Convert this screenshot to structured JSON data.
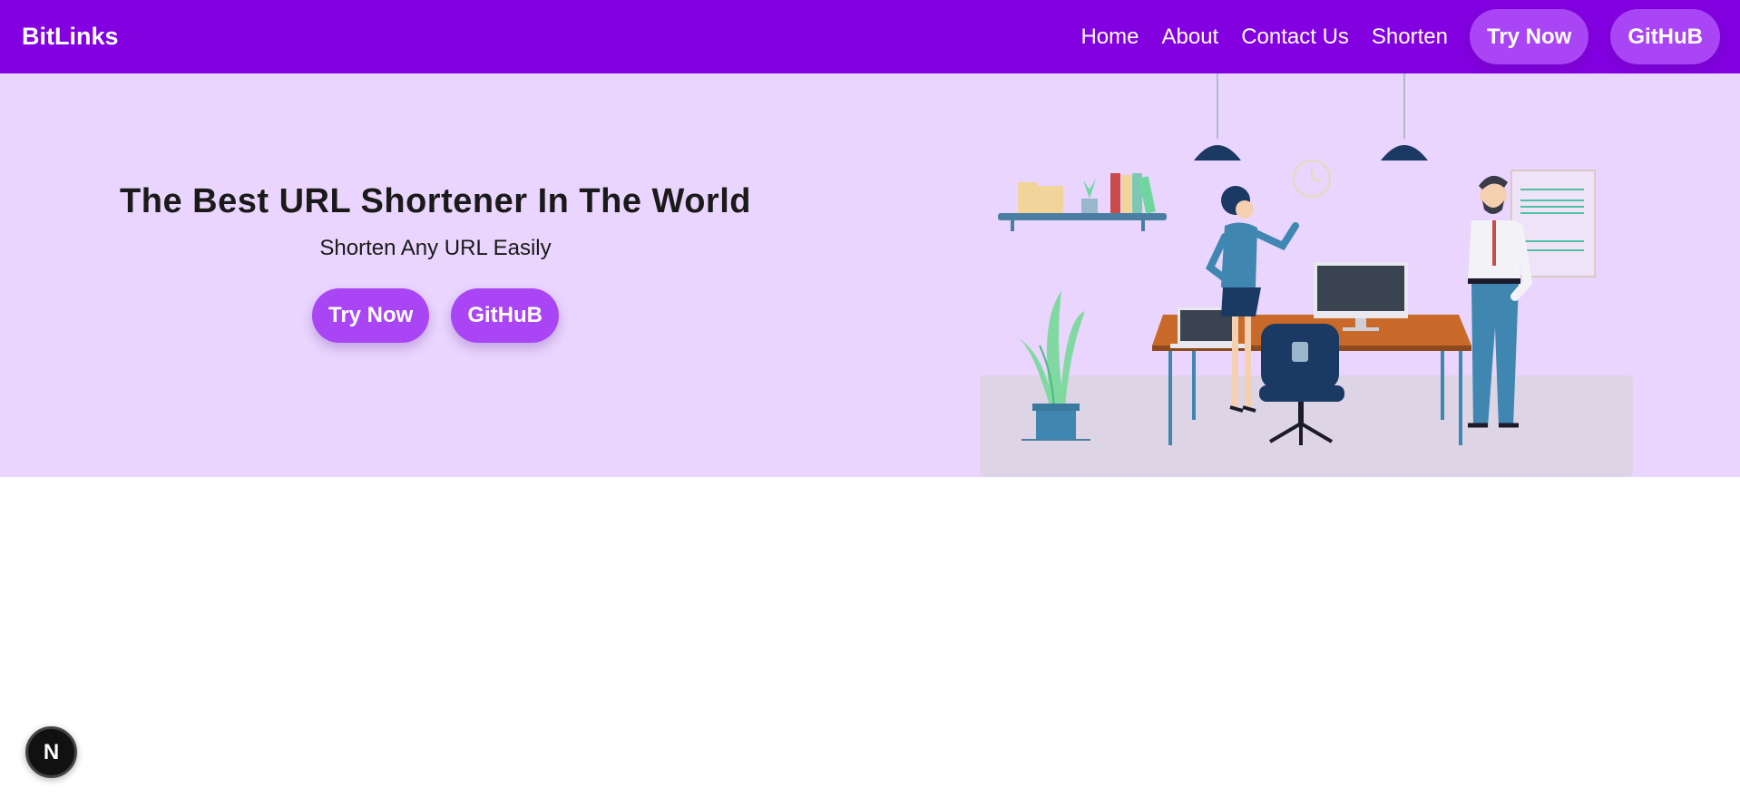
{
  "navbar": {
    "brand": "BitLinks",
    "links": [
      "Home",
      "About",
      "Contact Us",
      "Shorten"
    ],
    "try_now": "Try Now",
    "github": "GitHuB"
  },
  "hero": {
    "title": "The Best URL Shortener In The World",
    "subtitle": "Shorten Any URL Easily",
    "try_now": "Try Now",
    "github": "GitHuB"
  },
  "illustration": {
    "icon": "office-illustration"
  },
  "dev_badge": {
    "letter": "N",
    "icon": "nextjs-icon"
  },
  "colors": {
    "navbar": "#8300e0",
    "button": "#a945f5",
    "hero_bg": "#e9d5fd",
    "text": "#1a1a1a"
  }
}
